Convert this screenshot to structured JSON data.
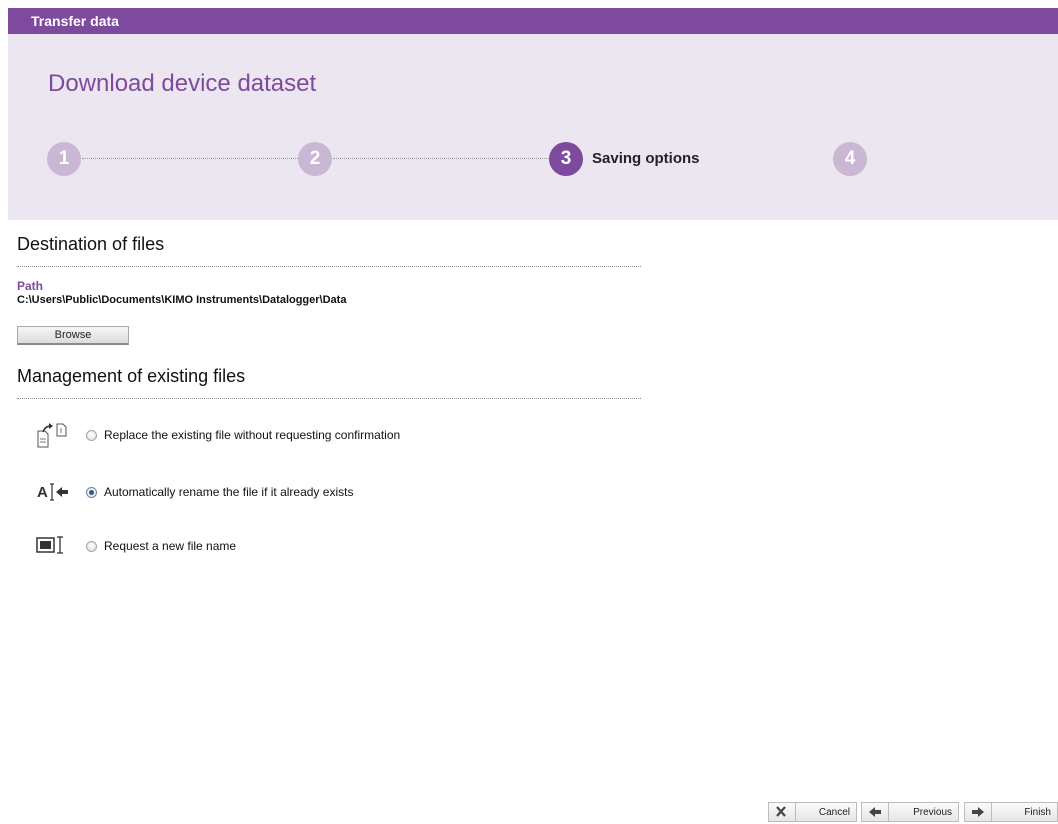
{
  "window": {
    "title": "Transfer data"
  },
  "header": {
    "title": "Download device dataset",
    "steps": [
      {
        "number": "1",
        "label": ""
      },
      {
        "number": "2",
        "label": ""
      },
      {
        "number": "3",
        "label": "Saving options"
      },
      {
        "number": "4",
        "label": ""
      }
    ],
    "active_step": 3,
    "colors": {
      "accent": "#7e4a9e",
      "inactive_step": "#c9b7d3",
      "header_bg": "#ece6f0"
    }
  },
  "destination": {
    "heading": "Destination of files",
    "path_label": "Path",
    "path_value": "C:\\Users\\Public\\Documents\\KIMO Instruments\\Datalogger\\Data",
    "browse_label": "Browse"
  },
  "management": {
    "heading": "Management of existing files",
    "options": [
      {
        "label": "Replace the existing file without requesting confirmation",
        "icon": "replace-file-icon",
        "selected": false
      },
      {
        "label": "Automatically rename the file if it already exists",
        "icon": "rename-file-icon",
        "selected": true
      },
      {
        "label": "Request a new file name",
        "icon": "new-name-icon",
        "selected": false
      }
    ]
  },
  "footer": {
    "cancel_label": "Cancel",
    "previous_label": "Previous",
    "finish_label": "Finish"
  }
}
